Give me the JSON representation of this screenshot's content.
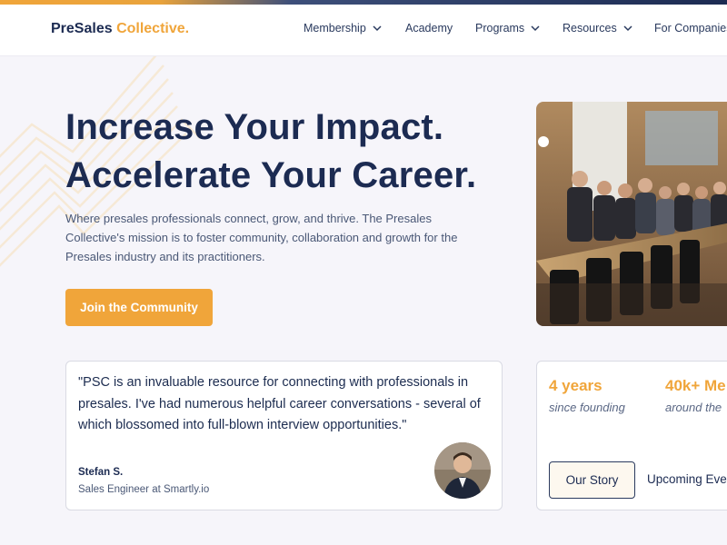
{
  "brand": {
    "part1": "PreSales",
    "part2": "Collective.",
    "colors": {
      "navy": "#1c2b52",
      "orange": "#f0a53a"
    }
  },
  "nav": {
    "items": [
      {
        "label": "Membership",
        "dropdown": true
      },
      {
        "label": "Academy",
        "dropdown": false
      },
      {
        "label": "Programs",
        "dropdown": true
      },
      {
        "label": "Resources",
        "dropdown": true
      },
      {
        "label": "For Companies",
        "dropdown": false
      }
    ]
  },
  "hero": {
    "headline_line1": "Increase Your Impact.",
    "headline_line2": "Accelerate Your Career.",
    "intro": "Where presales professionals connect, grow, and thrive. The Presales Collective's mission is to foster community, collaboration and growth for the Presales industry and its practitioners.",
    "cta_label": "Join the Community",
    "photo_icon": "group-photo"
  },
  "testimonial": {
    "quote": "\"PSC is an invaluable resource for connecting with professionals in presales. I've had numerous helpful career conversations - several of which blossomed into full-blown interview opportunities.\"",
    "name": "Stefan S.",
    "role": "Sales Engineer at Smartly.io",
    "avatar_icon": "person-avatar"
  },
  "stats": {
    "items": [
      {
        "value": "4 years",
        "label": "since founding"
      },
      {
        "value": "40k+ Me",
        "label": "around the"
      }
    ],
    "our_story_label": "Our Story",
    "events_label": "Upcoming Eve"
  }
}
